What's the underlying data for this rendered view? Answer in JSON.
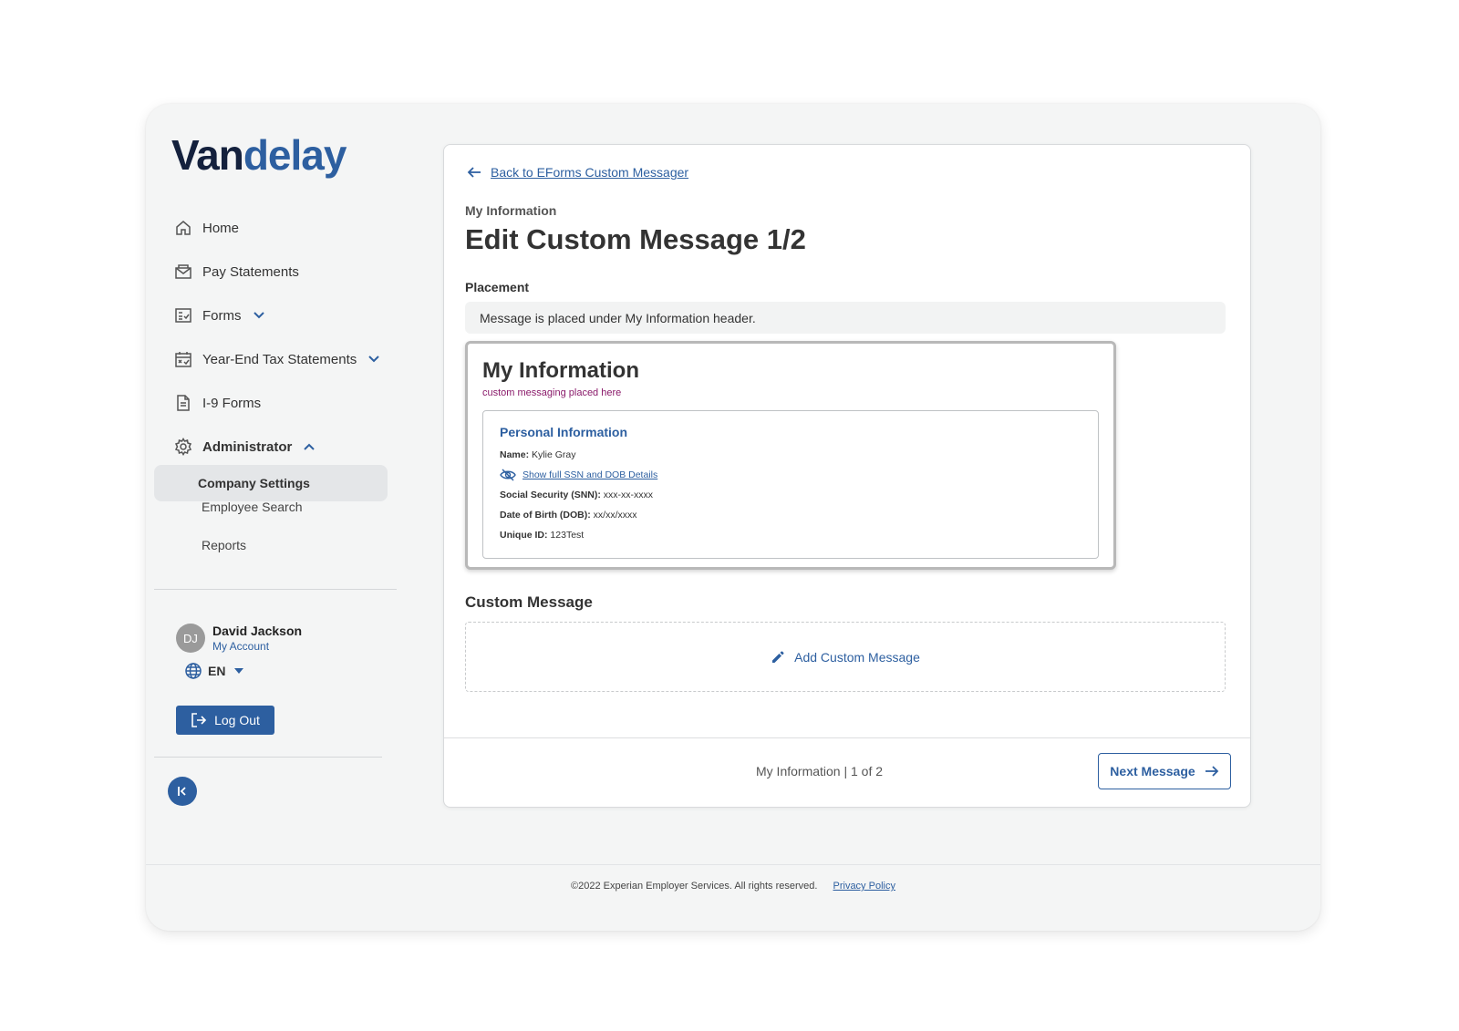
{
  "brand": {
    "part1": "Van",
    "part2": "delay"
  },
  "sidebar": {
    "items": [
      {
        "label": "Home"
      },
      {
        "label": "Pay Statements"
      },
      {
        "label": "Forms"
      },
      {
        "label": "Year-End Tax Statements"
      },
      {
        "label": "I-9 Forms"
      },
      {
        "label": "Administrator"
      }
    ],
    "sub_items": [
      {
        "label": "Company Settings"
      },
      {
        "label": "Employee Search"
      },
      {
        "label": "Reports"
      }
    ]
  },
  "user": {
    "initials": "DJ",
    "name": "David Jackson",
    "account_link": "My Account"
  },
  "language": {
    "code": "EN"
  },
  "logout_label": "Log Out",
  "main": {
    "back_link": "Back to EForms Custom Messager",
    "eyebrow": "My Information",
    "title": "Edit Custom Message 1/2",
    "placement_label": "Placement",
    "placement_text": "Message is placed under My Information header.",
    "preview": {
      "title": "My Information",
      "note": "custom messaging placed here",
      "section_title": "Personal Information",
      "name_label": "Name:",
      "name_value": "Kylie Gray",
      "show_link": "Show full SSN and DOB Details",
      "ssn_label": "Social Security (SNN):",
      "ssn_value": "xxx-xx-xxxx",
      "dob_label": "Date of Birth (DOB):",
      "dob_value": "xx/xx/xxxx",
      "uid_label": "Unique ID:",
      "uid_value": "123Test"
    },
    "custom_label": "Custom Message",
    "add_label": "Add Custom Message",
    "pager": "My Information | 1 of 2",
    "next_label": "Next Message"
  },
  "footer": {
    "copyright": "©2022 Experian Employer Services. All rights reserved.",
    "privacy": "Privacy Policy"
  },
  "colors": {
    "accent": "#2d5fa0",
    "brand_dark": "#14213d",
    "note": "#8a1a6a"
  }
}
